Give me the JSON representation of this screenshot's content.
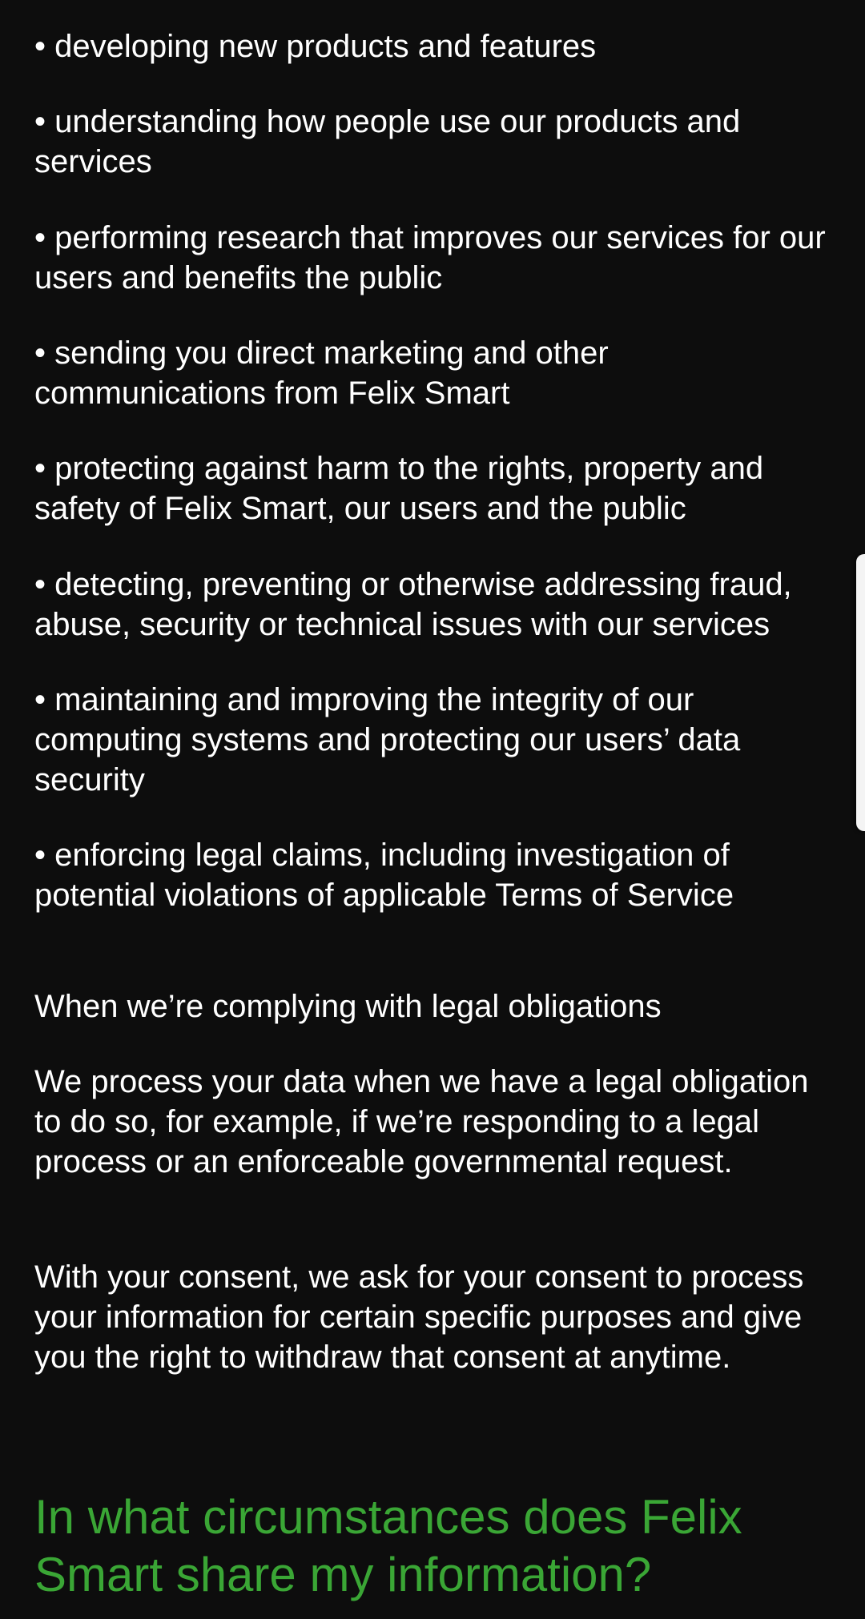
{
  "bullets": [
    "developing new products and features",
    "understanding how people use our products and services",
    "performing research that improves our services for our users and benefits the public",
    "sending you direct marketing and other communications from Felix Smart",
    "protecting against harm to the rights, property and safety of Felix Smart, our users and the public",
    "detecting, preventing or otherwise addressing fraud, abuse, security or technical issues with our services",
    "maintaining and improving the integrity of our computing systems and protecting our users’ data security",
    "enforcing legal claims, including investigation of potential violations of applicable Terms of Service"
  ],
  "legal_section": {
    "subheading": "When we’re complying with legal obligations",
    "paragraph": "We process your data when we have a legal obligation to do so, for example, if we’re responding to a legal process or an enforceable governmental request.",
    "consent_paragraph": "With your consent, we ask for your consent to process your information for certain specific purposes and give you the right to withdraw that consent at anytime."
  },
  "next_section": {
    "heading": "In what circumstances does Felix Smart share my information?"
  },
  "colors": {
    "background": "#0d0d0d",
    "text": "#ffffff",
    "heading_accent": "#3aa635",
    "scroll_handle": "#f4f4f4"
  }
}
